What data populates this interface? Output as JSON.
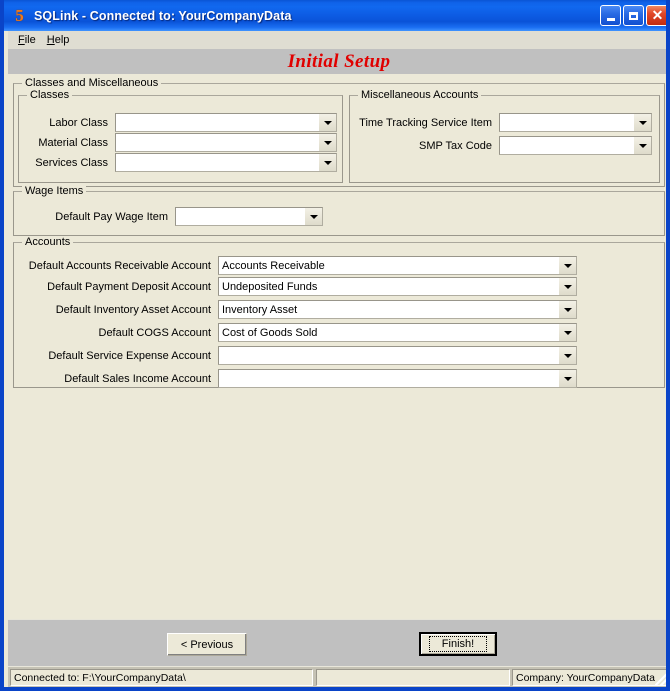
{
  "window": {
    "icon": "app-5-icon",
    "title": "SQLink - Connected to: YourCompanyData",
    "minimize_label": "Minimize",
    "maximize_label": "Maximize",
    "close_label": "Close"
  },
  "menu": {
    "items": [
      {
        "label": "File",
        "accel": "F"
      },
      {
        "label": "Help",
        "accel": "H"
      }
    ]
  },
  "header": {
    "title": "Initial Setup",
    "color": "#e00000"
  },
  "groups": {
    "classes_misc": {
      "label": "Classes and Miscellaneous"
    },
    "classes": {
      "label": "Classes",
      "fields": [
        {
          "label": "Labor Class",
          "value": "",
          "name": "labor-class"
        },
        {
          "label": "Material Class",
          "value": "",
          "name": "material-class"
        },
        {
          "label": "Services Class",
          "value": "",
          "name": "services-class"
        }
      ]
    },
    "misc_accounts": {
      "label": "Miscellaneous Accounts",
      "fields": [
        {
          "label": "Time Tracking Service Item",
          "value": "",
          "name": "time-tracking-service-item"
        },
        {
          "label": "SMP Tax Code",
          "value": "",
          "name": "smp-tax-code"
        }
      ]
    },
    "wage_items": {
      "label": "Wage Items",
      "fields": [
        {
          "label": "Default Pay Wage Item",
          "value": "",
          "name": "default-pay-wage-item"
        }
      ]
    },
    "accounts": {
      "label": "Accounts",
      "fields": [
        {
          "label": "Default Accounts Receivable Account",
          "value": "Accounts Receivable",
          "name": "default-accounts-receivable-account"
        },
        {
          "label": "Default Payment Deposit Account",
          "value": "Undeposited Funds",
          "name": "default-payment-deposit-account"
        },
        {
          "label": "Default Inventory Asset Account",
          "value": "Inventory Asset",
          "name": "default-inventory-asset-account"
        },
        {
          "label": "Default COGS Account",
          "value": "Cost of Goods Sold",
          "name": "default-cogs-account"
        },
        {
          "label": "Default Service Expense Account",
          "value": "",
          "name": "default-service-expense-account"
        },
        {
          "label": "Default Sales Income Account",
          "value": "",
          "name": "default-sales-income-account"
        }
      ]
    }
  },
  "buttons": {
    "previous": "< Previous",
    "finish": "Finish!"
  },
  "statusbar": {
    "panel1": "Connected to: F:\\YourCompanyData\\",
    "panel2": "",
    "panel3": "Company: YourCompanyData"
  }
}
